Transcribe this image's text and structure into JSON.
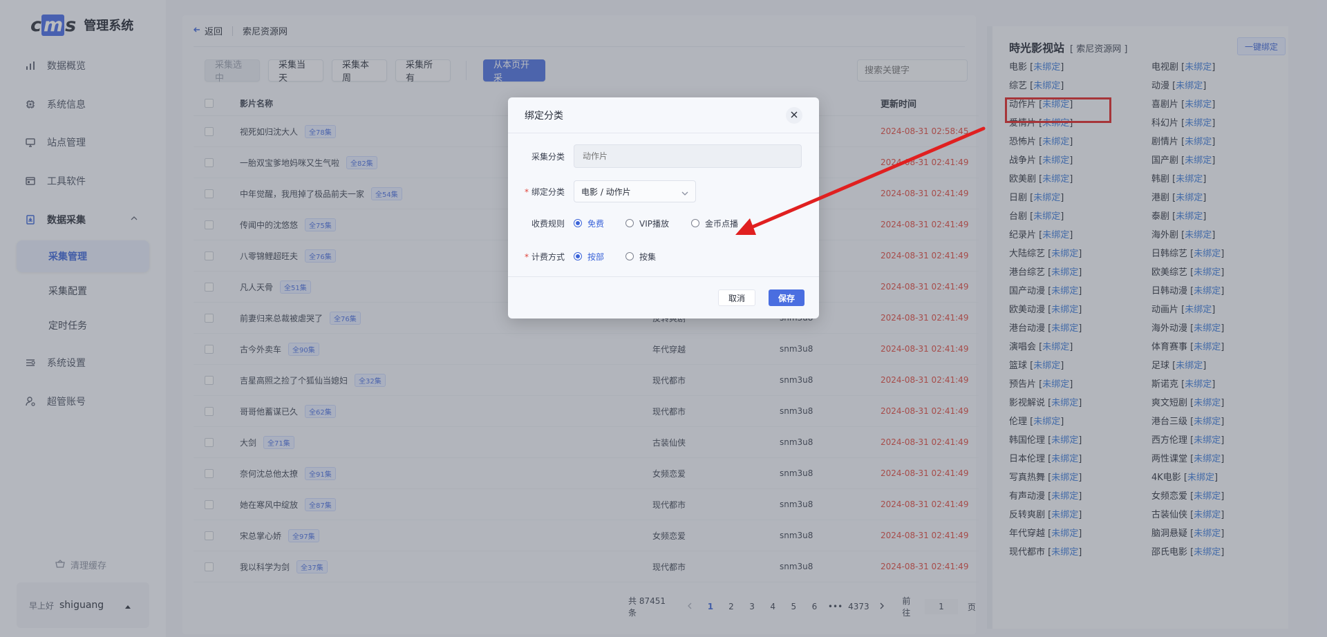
{
  "logo": {
    "mark_a": "c",
    "mark_m": "m",
    "mark_b": "s",
    "text": "管理系统"
  },
  "nav": {
    "overview": "数据概览",
    "sysinfo": "系统信息",
    "site": "站点管理",
    "tools": "工具软件",
    "collect": "数据采集",
    "collect_manage": "采集管理",
    "collect_config": "采集配置",
    "schedule": "定时任务",
    "settings": "系统设置",
    "admin": "超管账号"
  },
  "clear_cache": "清理缓存",
  "user": {
    "greeting": "早上好",
    "name": "shiguang"
  },
  "topbar": {
    "back": "返回",
    "crumb": "索尼资源网"
  },
  "toolbar": {
    "collect_selected": "采集选中",
    "collect_today": "采集当天",
    "collect_week": "采集本周",
    "collect_all": "采集所有",
    "collect_from_page": "从本页开采",
    "search_placeholder": "搜索关键字"
  },
  "table": {
    "headers": {
      "name": "影片名称",
      "time": "更新时间"
    },
    "rows": [
      {
        "name": "视死如归沈大人",
        "ep": "全78集",
        "cat": "",
        "src": "",
        "time": "2024-08-31 02:58:45"
      },
      {
        "name": "一胎双宝爹地妈咪又生气啦",
        "ep": "全82集",
        "cat": "",
        "src": "",
        "time": "2024-08-31 02:41:49"
      },
      {
        "name": "中年觉醒，我甩掉了极品前夫一家",
        "ep": "全54集",
        "cat": "",
        "src": "",
        "time": "2024-08-31 02:41:49"
      },
      {
        "name": "传闻中的沈悠悠",
        "ep": "全75集",
        "cat": "",
        "src": "",
        "time": "2024-08-31 02:41:49"
      },
      {
        "name": "八零锦鲤超旺夫",
        "ep": "全76集",
        "cat": "",
        "src": "",
        "time": "2024-08-31 02:41:49"
      },
      {
        "name": "凡人天骨",
        "ep": "全51集",
        "cat": "",
        "src": "",
        "time": "2024-08-31 02:41:49"
      },
      {
        "name": "前妻归来总裁被虐哭了",
        "ep": "全76集",
        "cat": "反转爽剧",
        "src": "snm3u8",
        "time": "2024-08-31 02:41:49"
      },
      {
        "name": "古今外卖车",
        "ep": "全90集",
        "cat": "年代穿越",
        "src": "snm3u8",
        "time": "2024-08-31 02:41:49"
      },
      {
        "name": "吉星高照之捡了个狐仙当媳妇",
        "ep": "全32集",
        "cat": "现代都市",
        "src": "snm3u8",
        "time": "2024-08-31 02:41:49"
      },
      {
        "name": "哥哥他蓄谋已久",
        "ep": "全62集",
        "cat": "现代都市",
        "src": "snm3u8",
        "time": "2024-08-31 02:41:49"
      },
      {
        "name": "大剑",
        "ep": "全71集",
        "cat": "古装仙侠",
        "src": "snm3u8",
        "time": "2024-08-31 02:41:49"
      },
      {
        "name": "奈何沈总他太撩",
        "ep": "全91集",
        "cat": "女频恋爱",
        "src": "snm3u8",
        "time": "2024-08-31 02:41:49"
      },
      {
        "name": "她在寒风中绽放",
        "ep": "全87集",
        "cat": "现代都市",
        "src": "snm3u8",
        "time": "2024-08-31 02:41:49"
      },
      {
        "name": "宋总掌心娇",
        "ep": "全97集",
        "cat": "女频恋爱",
        "src": "snm3u8",
        "time": "2024-08-31 02:41:49"
      },
      {
        "name": "我以科学为剑",
        "ep": "全37集",
        "cat": "现代都市",
        "src": "snm3u8",
        "time": "2024-08-31 02:41:49"
      }
    ]
  },
  "pager": {
    "total": "共 87451 条",
    "pages": [
      "1",
      "2",
      "3",
      "4",
      "5",
      "6",
      "•••",
      "4373"
    ],
    "goto": "前往",
    "current": "1",
    "unit": "页"
  },
  "right": {
    "title": "時光影视站",
    "subtitle": "[ 索尼资源网 ]",
    "bind_all": "一键绑定",
    "unbound": "未绑定",
    "left_col": [
      "电影",
      "综艺",
      "动作片",
      "爱情片",
      "恐怖片",
      "战争片",
      "欧美剧",
      "日剧",
      "台剧",
      "纪录片",
      "大陆综艺",
      "港台综艺",
      "国产动漫",
      "欧美动漫",
      "港台动漫",
      "演唱会",
      "篮球",
      "预告片",
      "影视解说",
      "伦理",
      "韩国伦理",
      "日本伦理",
      "写真热舞",
      "有声动漫",
      "反转爽剧",
      "年代穿越",
      "现代都市"
    ],
    "right_col": [
      "电视剧",
      "动漫",
      "喜剧片",
      "科幻片",
      "剧情片",
      "国产剧",
      "韩剧",
      "港剧",
      "泰剧",
      "海外剧",
      "日韩综艺",
      "欧美综艺",
      "日韩动漫",
      "动画片",
      "海外动漫",
      "体育赛事",
      "足球",
      "斯诺克",
      "爽文短剧",
      "港台三级",
      "西方伦理",
      "两性课堂",
      "4K电影",
      "女频恋爱",
      "古装仙侠",
      "脑洞悬疑",
      "邵氏电影"
    ]
  },
  "dialog": {
    "title": "绑定分类",
    "collect_cat_label": "采集分类",
    "collect_cat_value": "动作片",
    "bind_cat_label": "绑定分类",
    "bind_cat_value": "电影 / 动作片",
    "fee_rule_label": "收费规则",
    "fee_options": [
      "免费",
      "VIP播放",
      "金币点播"
    ],
    "billing_label": "计费方式",
    "billing_options": [
      "按部",
      "按集"
    ],
    "cancel": "取消",
    "save": "保存"
  },
  "colors": {
    "accent": "#4a6ee0",
    "time_red": "#e0463c",
    "highlight_red": "#e02020",
    "unbound_link": "#3a78d8"
  }
}
